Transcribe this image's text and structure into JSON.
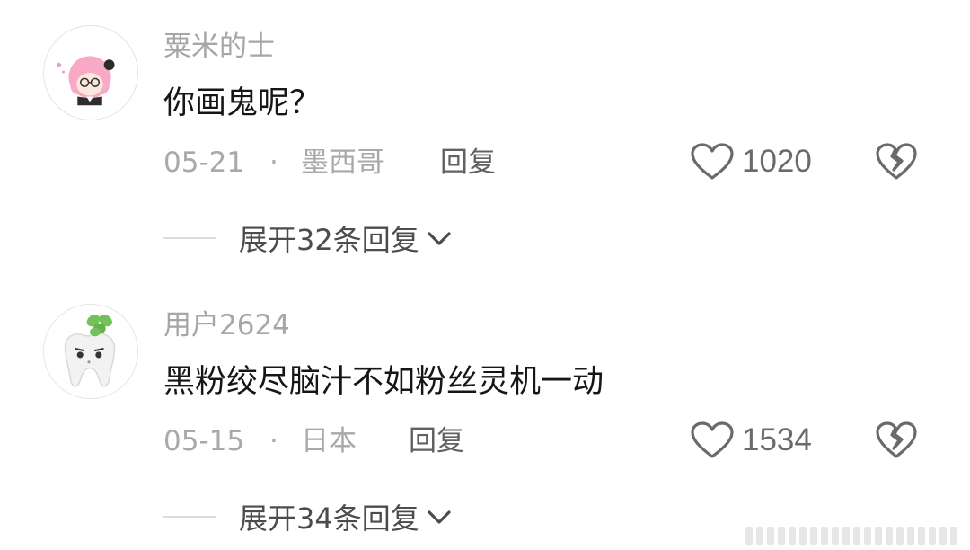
{
  "comments": [
    {
      "username": "粟米的士",
      "text": "你画鬼呢？",
      "date": "05-21",
      "separator": "·",
      "location": "墨西哥",
      "reply_label": "回复",
      "likes": "1020",
      "expand_label": "展开32条回复",
      "avatar_icon": "pink-hair-girl-avatar"
    },
    {
      "username": "用户2624",
      "text": "黑粉绞尽脑汁不如粉丝灵机一动",
      "date": "05-15",
      "separator": "·",
      "location": "日本",
      "reply_label": "回复",
      "likes": "1534",
      "expand_label": "展开34条回复",
      "avatar_icon": "tooth-sprout-avatar"
    }
  ],
  "icons": {
    "like": "heart-outline-icon",
    "dislike": "broken-heart-icon",
    "expand": "chevron-down-icon"
  },
  "colors": {
    "username": "#a6a6a6",
    "text": "#161616",
    "meta": "#a9a9a9",
    "reply": "#616161",
    "icon": "#6a6a6a"
  }
}
